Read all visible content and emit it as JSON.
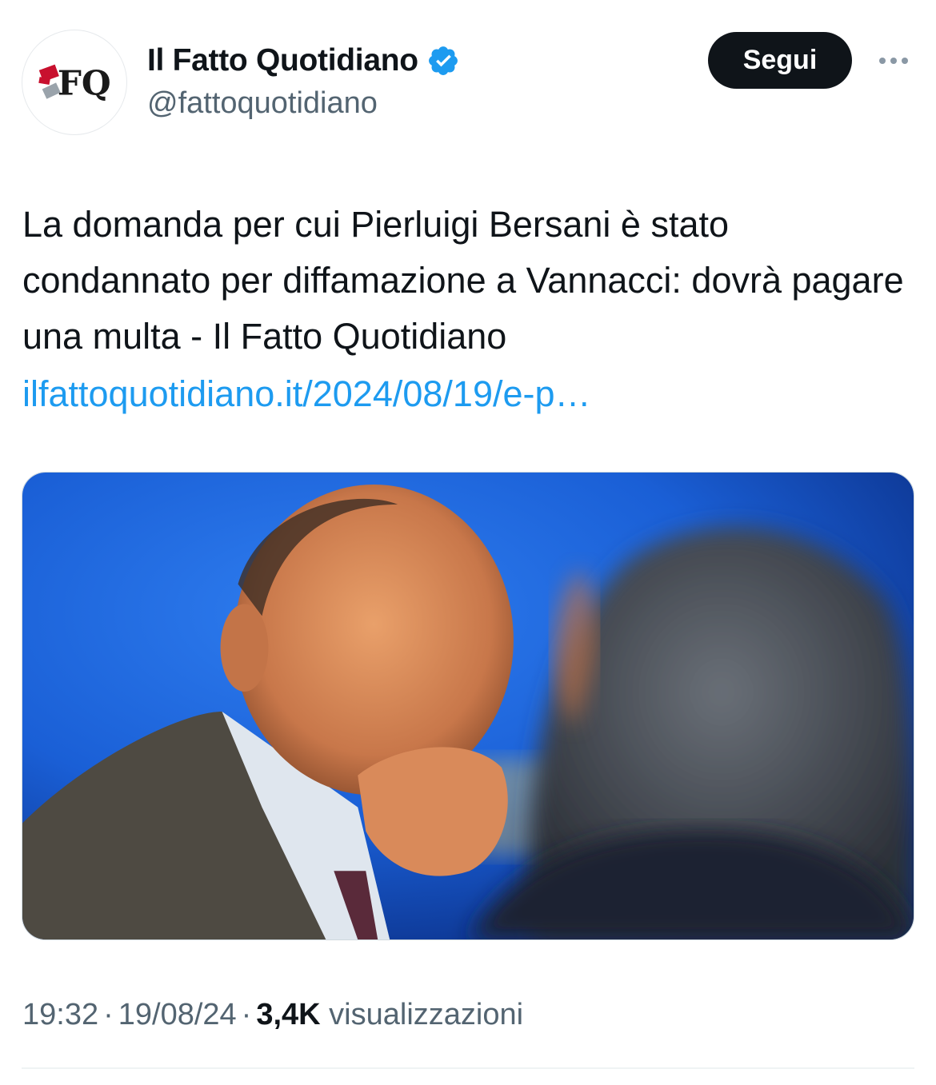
{
  "author": {
    "display_name": "Il Fatto Quotidiano",
    "handle": "@fattoquotidiano",
    "verified": true,
    "avatar_icon": "fq-logo-icon",
    "verified_icon": "verified-badge-icon",
    "avatar_text": "FQ"
  },
  "actions": {
    "follow_label": "Segui",
    "more_icon": "more-dots-icon"
  },
  "tweet": {
    "text": "La domanda per cui Pierluigi Bersani è stato condannato per diffamazione a Vannacci: dovrà pagare una multa - Il Fatto Quotidiano",
    "link": "ilfattoquotidiano.it/2024/08/19/e-p…"
  },
  "meta": {
    "time": "19:32",
    "separator": "·",
    "date": "19/08/24",
    "views_count": "3,4K",
    "views_label": "visualizzazioni"
  },
  "colors": {
    "link": "#1d9bf0",
    "verified": "#1d9bf0",
    "secondary_text": "#536471",
    "button_bg": "#0f1419"
  }
}
